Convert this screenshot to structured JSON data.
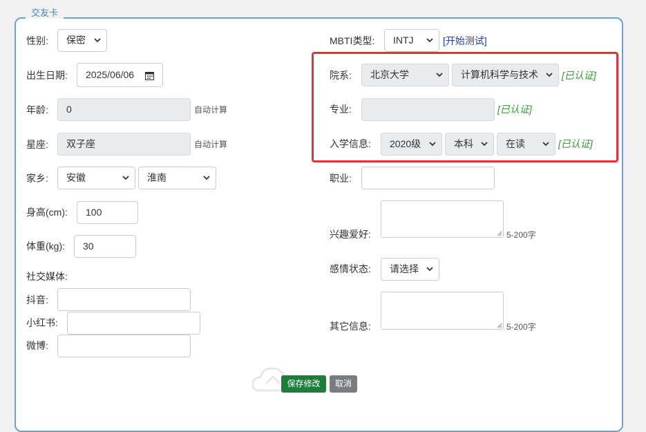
{
  "card": {
    "legend": "交友卡"
  },
  "left": {
    "gender": {
      "label": "性别:",
      "value": "保密"
    },
    "birth": {
      "label": "出生日期:",
      "value": "2025/06/06",
      "icon": "calendar-icon"
    },
    "age": {
      "label": "年龄:",
      "value": "0",
      "note": "自动计算"
    },
    "zodiac": {
      "label": "星座:",
      "value": "双子座",
      "note": "自动计算"
    },
    "hometown": {
      "label": "家乡:",
      "province": "安徽",
      "city": "淮南"
    },
    "height": {
      "label": "身高(cm):",
      "value": "100"
    },
    "weight": {
      "label": "体重(kg):",
      "value": "30"
    },
    "social": {
      "label": "社交媒体:",
      "douyin": {
        "label": "抖音:",
        "value": ""
      },
      "xiaohongshu": {
        "label": "小红书:",
        "value": ""
      },
      "weibo": {
        "label": "微博:",
        "value": ""
      }
    }
  },
  "right": {
    "mbti": {
      "label": "MBTI类型:",
      "value": "INTJ",
      "test_link": "[开始测试]"
    },
    "school": {
      "label": "院系:",
      "university": "北京大学",
      "department": "计算机科学与技术",
      "verified": "[已认证]"
    },
    "major": {
      "label": "专业:",
      "value": "",
      "verified": "[已认证]"
    },
    "enroll": {
      "label": "入学信息:",
      "year": "2020级",
      "degree": "本科",
      "status": "在读",
      "verified": "[已认证]"
    },
    "job": {
      "label": "职业:",
      "value": ""
    },
    "hobby": {
      "label": "兴趣爱好:",
      "note": "5-200字"
    },
    "relationship": {
      "label": "感情状态:",
      "value": "请选择"
    },
    "other": {
      "label": "其它信息:",
      "note": "5-200字"
    }
  },
  "actions": {
    "save": "保存修改",
    "cancel": "取消"
  },
  "colors": {
    "border": "#6d9ed6",
    "highlight": "#e03434",
    "verified": "#2e9a2e",
    "link": "#1a3fbf",
    "save": "#1e7d3a"
  }
}
